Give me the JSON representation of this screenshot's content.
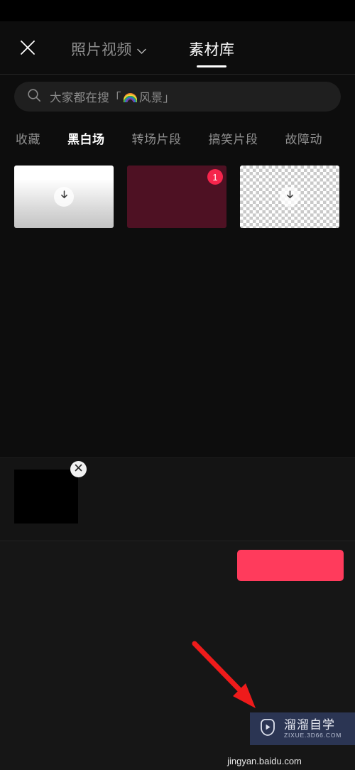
{
  "header": {
    "close_icon": "close-icon",
    "tabs": [
      {
        "label": "照片视频",
        "icon": "chevron-down-icon",
        "active": false
      },
      {
        "label": "素材库",
        "icon": "",
        "active": true
      }
    ]
  },
  "search": {
    "icon": "search-icon",
    "placeholder": "大家都在搜「",
    "placeholder_suffix": "风景」",
    "emoji": "rainbow-icon",
    "value": ""
  },
  "categories": [
    {
      "label": "收藏",
      "active": false
    },
    {
      "label": "黑白场",
      "active": true
    },
    {
      "label": "转场片段",
      "active": false
    },
    {
      "label": "搞笑片段",
      "active": false
    },
    {
      "label": "故障动",
      "active": false
    }
  ],
  "grid": {
    "items": [
      {
        "name": "white-gradient-clip",
        "style": "gradient",
        "download_icon": "download-icon",
        "badge": ""
      },
      {
        "name": "maroon-clip",
        "style": "maroon",
        "download_icon": "",
        "badge": "1"
      },
      {
        "name": "transparent-clip",
        "style": "checker",
        "download_icon": "download-icon",
        "badge": ""
      }
    ]
  },
  "timeline": {
    "clips": [
      {
        "name": "black-clip",
        "remove_icon": "close-icon"
      }
    ]
  },
  "actionbar": {
    "confirm_label": ""
  },
  "annotation": {
    "arrow_color": "#ee1b1b"
  },
  "watermark": {
    "logo_icon": "play-logo-icon",
    "title": "溜溜自学",
    "subtitle": "ZIXUE.3D66.COM"
  },
  "footer": {
    "site": "jingyan.baidu.com"
  },
  "colors": {
    "background": "#0d0d0d",
    "accent_pink": "#ff3b5c",
    "badge": "#f5254c",
    "search_bg": "#1f1f1f",
    "maroon": "#4e1123",
    "watermark_bg": "#2b3553"
  }
}
